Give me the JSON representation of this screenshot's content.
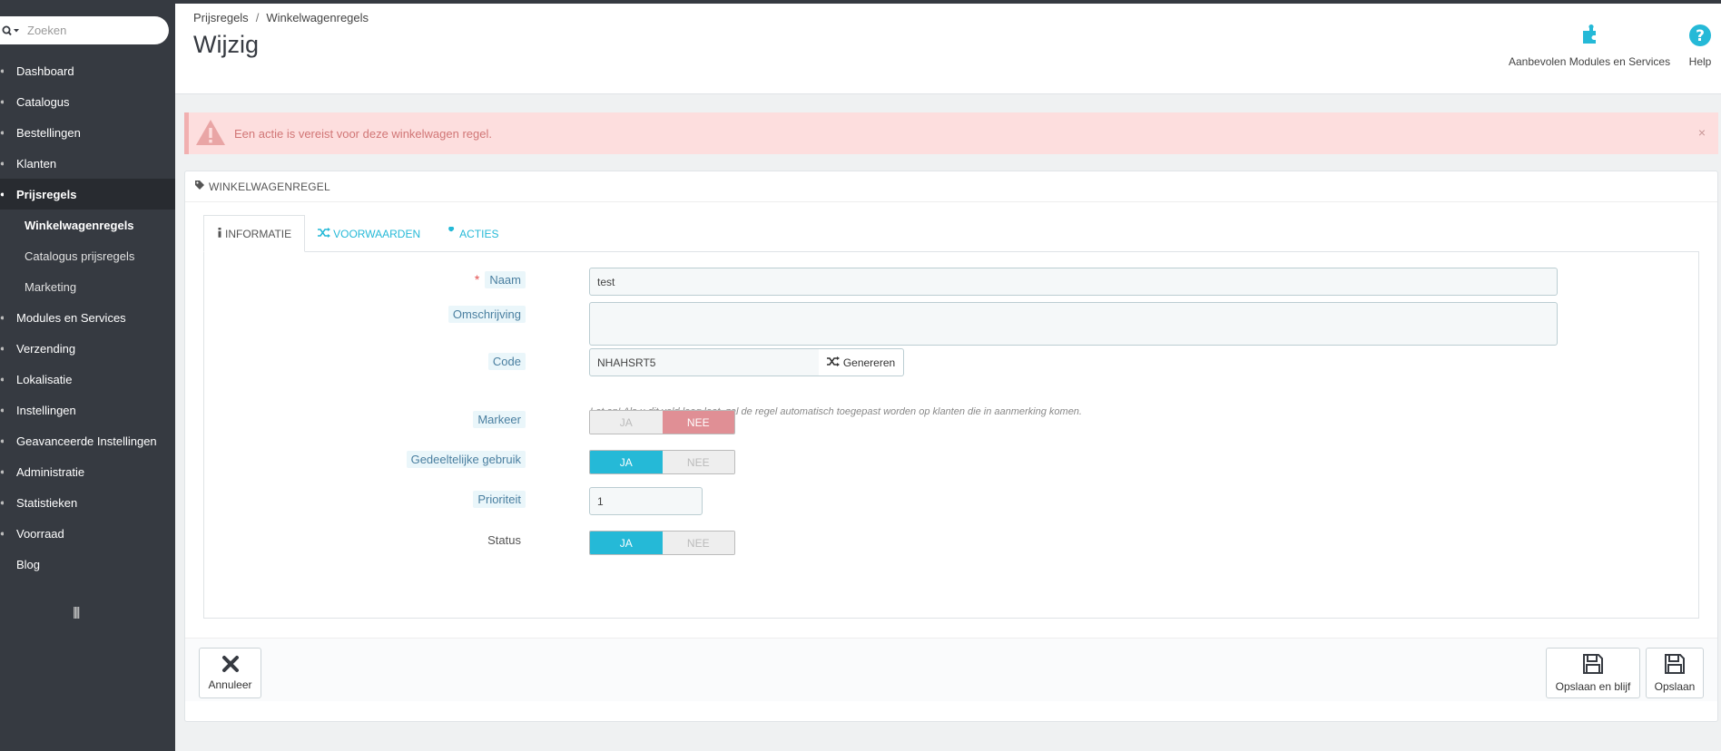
{
  "sidebar": {
    "search_placeholder": "Zoeken",
    "items": [
      {
        "label": "Dashboard"
      },
      {
        "label": "Catalogus"
      },
      {
        "label": "Bestellingen"
      },
      {
        "label": "Klanten"
      },
      {
        "label": "Prijsregels"
      },
      {
        "label": "Modules en Services"
      },
      {
        "label": "Verzending"
      },
      {
        "label": "Lokalisatie"
      },
      {
        "label": "Instellingen"
      },
      {
        "label": "Geavanceerde Instellingen"
      },
      {
        "label": "Administratie"
      },
      {
        "label": "Statistieken"
      },
      {
        "label": "Voorraad"
      },
      {
        "label": "Blog"
      }
    ],
    "subitems": [
      {
        "label": "Winkelwagenregels"
      },
      {
        "label": "Catalogus prijsregels"
      },
      {
        "label": "Marketing"
      }
    ]
  },
  "header": {
    "breadcrumb": [
      "Prijsregels",
      "/",
      "Winkelwagenregels"
    ],
    "title": "Wijzig",
    "modules_label": "Aanbevolen Modules en Services",
    "help_label": "Help"
  },
  "alert": {
    "message": "Een actie is vereist voor deze winkelwagen regel.",
    "close": "×"
  },
  "panel": {
    "heading": "WINKELWAGENREGEL",
    "tabs": [
      {
        "label": "INFORMATIE"
      },
      {
        "label": "VOORWAARDEN"
      },
      {
        "label": "ACTIES"
      }
    ]
  },
  "form": {
    "required_mark": "*",
    "naam_label": "Naam",
    "naam_value": "test",
    "omschrijving_label": "Omschrijving",
    "code_label": "Code",
    "code_value": "NHAHSRT5",
    "generate_label": "Genereren",
    "code_help": "Let op! Als u dit veld leeg laat, zal de regel automatisch toegepast worden op klanten die in aanmerking komen.",
    "markeer_label": "Markeer",
    "gedeeltelijk_label": "Gedeeltelijke gebruik",
    "prioriteit_label": "Prioriteit",
    "prioriteit_value": "1",
    "status_label": "Status",
    "yes": "JA",
    "no": "NEE",
    "markeer_value": "NEE",
    "gedeeltelijk_value": "JA",
    "status_value": "JA"
  },
  "footer": {
    "cancel_label": "Annuleer",
    "save_stay_label": "Opslaan en blijf",
    "save_label": "Opslaan"
  },
  "colors": {
    "sidebar_bg": "#363a41",
    "accent": "#25b9d7",
    "danger_toggle": "#e08f95",
    "alert_bg": "#fddede"
  }
}
